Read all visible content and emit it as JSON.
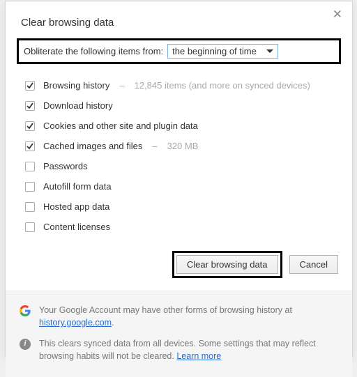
{
  "title": "Clear browsing data",
  "close_glyph": "✕",
  "obliterate": {
    "label": "Obliterate the following items from:",
    "selected": "the beginning of time"
  },
  "items": [
    {
      "checked": true,
      "label": "Browsing history",
      "hint": "12,845 items (and more on synced devices)"
    },
    {
      "checked": true,
      "label": "Download history",
      "hint": ""
    },
    {
      "checked": true,
      "label": "Cookies and other site and plugin data",
      "hint": ""
    },
    {
      "checked": true,
      "label": "Cached images and files",
      "hint": "320 MB"
    },
    {
      "checked": false,
      "label": "Passwords",
      "hint": ""
    },
    {
      "checked": false,
      "label": "Autofill form data",
      "hint": ""
    },
    {
      "checked": false,
      "label": "Hosted app data",
      "hint": ""
    },
    {
      "checked": false,
      "label": "Content licenses",
      "hint": ""
    }
  ],
  "buttons": {
    "primary": "Clear browsing data",
    "cancel": "Cancel"
  },
  "footer": {
    "line1_pre": "Your Google Account may have other forms of browsing history at ",
    "line1_link": "history.google.com",
    "line1_post": ".",
    "line2_pre": "This clears synced data from all devices. Some settings that may reflect browsing habits will not be cleared. ",
    "line2_link": "Learn more"
  }
}
